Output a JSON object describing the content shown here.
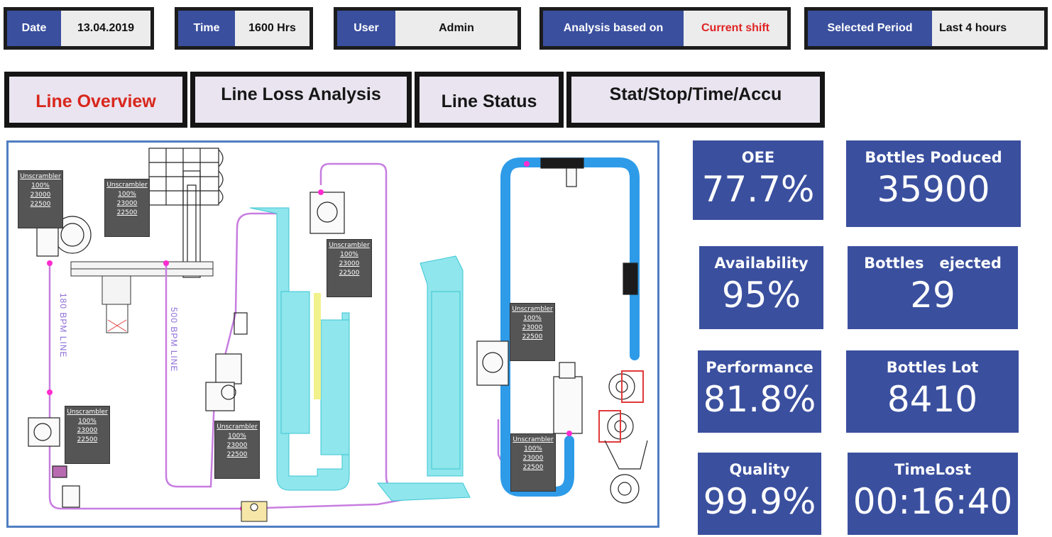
{
  "header": {
    "date": {
      "label": "Date",
      "value": "13.04.2019"
    },
    "time": {
      "label": "Time",
      "value": "1600 Hrs"
    },
    "user": {
      "label": "User",
      "value": "Admin"
    },
    "analysis": {
      "label": "Analysis based on",
      "value": "Current shift",
      "value_color": "#e02424"
    },
    "period": {
      "label": "Selected Period",
      "value": "Last 4 hours"
    }
  },
  "tabs": [
    {
      "label": "Line Overview",
      "active": true
    },
    {
      "label": "Line Loss Analysis",
      "active": false
    },
    {
      "label": "Line Status",
      "active": false
    },
    {
      "label": "Stat/Stop/Time/Accu",
      "active": false
    }
  ],
  "schematic": {
    "line_labels": [
      "180 BPM LINE",
      "500 BPM LINE"
    ],
    "machines": [
      {
        "name": "Unscrambler",
        "lines": [
          "100%",
          "23000",
          "22500"
        ]
      },
      {
        "name": "Unscrambler",
        "lines": [
          "100%",
          "23000",
          "22500"
        ]
      },
      {
        "name": "Unscrambler",
        "lines": [
          "100%",
          "23000",
          "22500"
        ]
      },
      {
        "name": "Unscrambler",
        "lines": [
          "100%",
          "23000",
          "22500"
        ]
      },
      {
        "name": "Unscrambler",
        "lines": [
          "100%",
          "23000",
          "22500"
        ]
      },
      {
        "name": "Unscrambler",
        "lines": [
          "100%",
          "23000",
          "22500"
        ]
      },
      {
        "name": "Unscrambler",
        "lines": [
          "100%",
          "23000",
          "22500"
        ]
      }
    ]
  },
  "kpis": {
    "oee": {
      "title": "OEE",
      "value": "77.7%"
    },
    "bottles_produced": {
      "title": "Bottles Poduced",
      "value": "35900"
    },
    "availability": {
      "title": "Availability",
      "value": "95%"
    },
    "bottles_ejected": {
      "title": "Bottles   ejected",
      "value": "29"
    },
    "performance": {
      "title": "Performance",
      "value": "81.8%"
    },
    "bottles_lot": {
      "title": "Bottles Lot",
      "value": "8410"
    },
    "quality": {
      "title": "Quality",
      "value": "99.9%"
    },
    "time_lost": {
      "title": "TimeLost",
      "value": "00:16:40"
    }
  },
  "colors": {
    "tile_blue": "#3a4f9e",
    "active_tab_red": "#d9261c",
    "conveyor_cyan": "#7fe0e8",
    "conveyor_blue": "#2e9be8",
    "line_violet": "#c77de0"
  }
}
